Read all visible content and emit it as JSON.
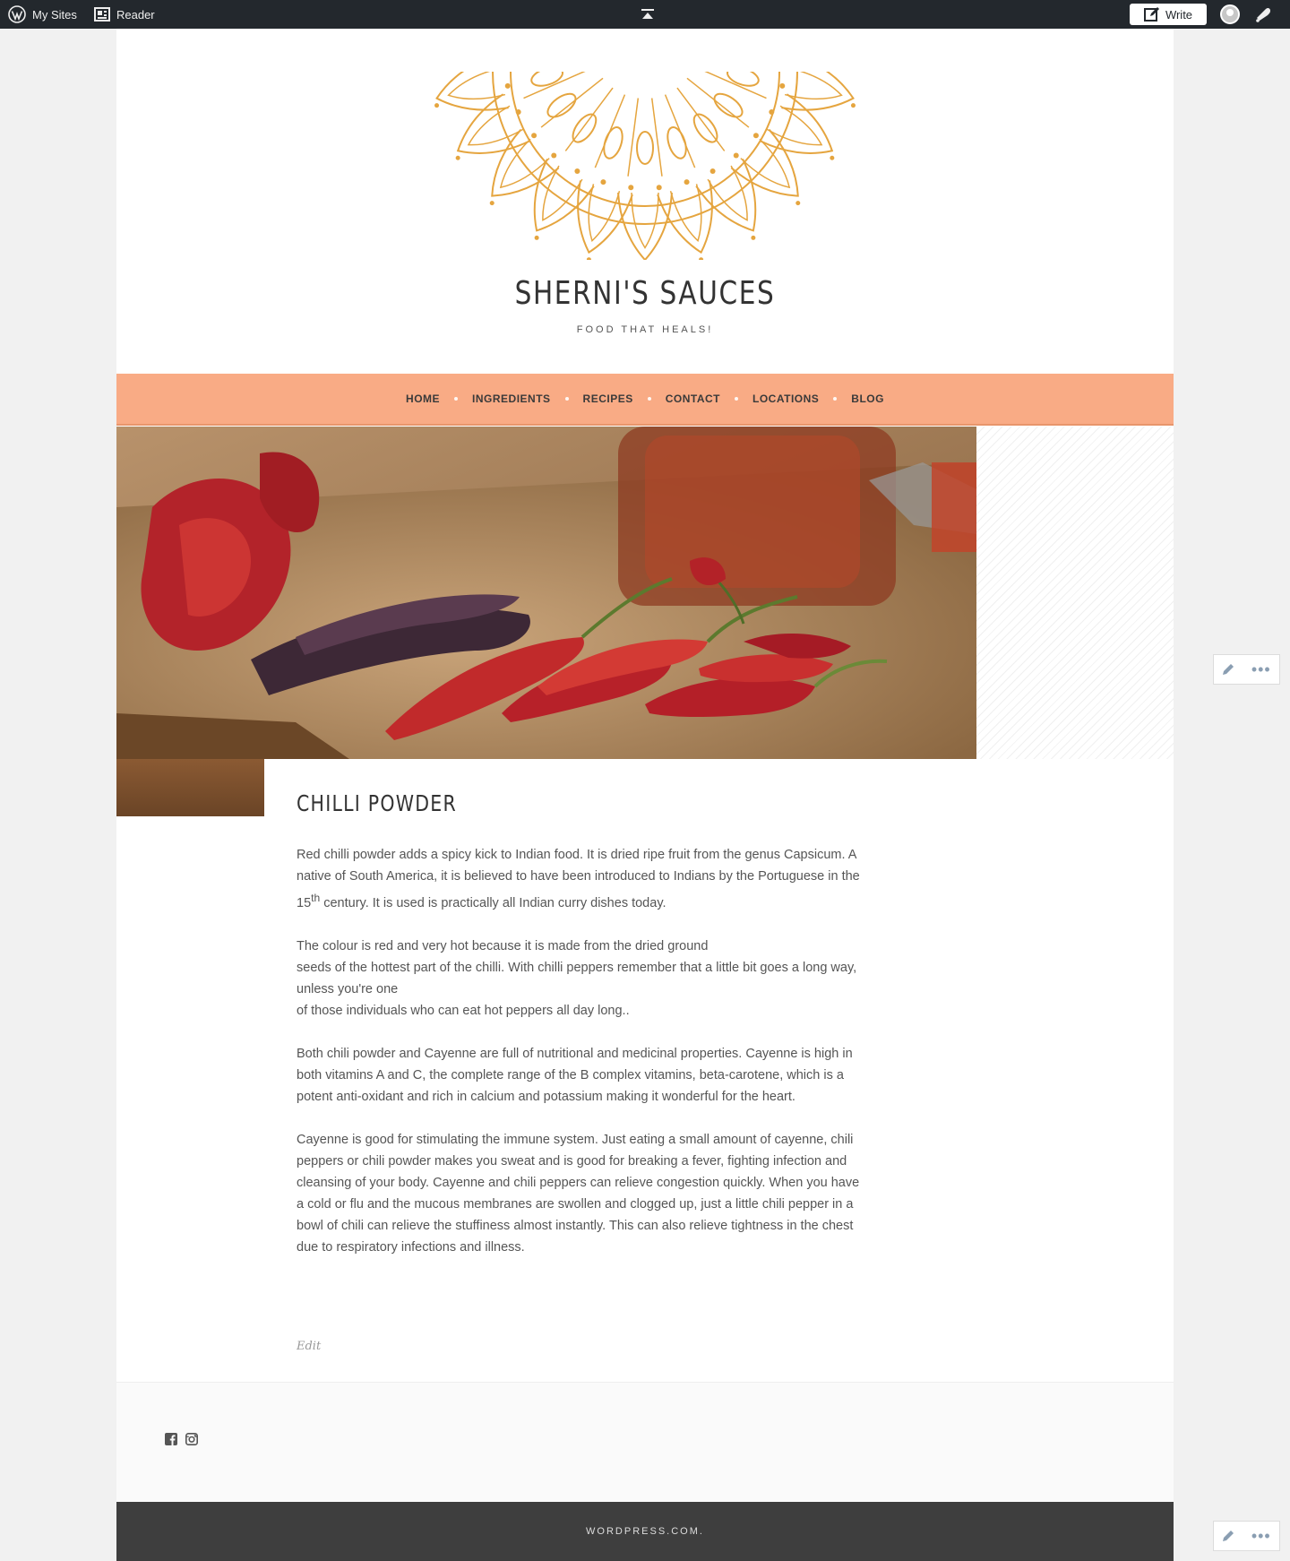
{
  "adminbar": {
    "my_sites": "My Sites",
    "reader": "Reader",
    "write": "Write"
  },
  "site": {
    "title": "SHERNI'S SAUCES",
    "tagline": "FOOD THAT HEALS!"
  },
  "nav": {
    "items": [
      "HOME",
      "INGREDIENTS",
      "RECIPES",
      "CONTACT",
      "LOCATIONS",
      "BLOG"
    ]
  },
  "post": {
    "title": "CHILLI POWDER",
    "para1_a": "Red chilli powder adds a spicy kick to Indian food. It is dried ripe fruit from the genus Capsicum. A native of South America, it is believed to have been introduced to Indians by the Portuguese in the 15",
    "para1_sup": "th",
    "para1_b": " century. It is used is practically all Indian curry dishes today.",
    "para2_line1": "The colour is red and very hot because it is made from the dried ground",
    "para2_line2": "seeds of the hottest part of the chilli. With chilli peppers remember that a little bit goes a long way, unless you're one",
    "para2_line3": "of those individuals who can eat hot peppers all day long..",
    "para3": "Both chili powder and Cayenne are full of nutritional and medicinal properties. Cayenne is high in both vitamins A and C, the complete range of the B complex vitamins, beta-carotene, which is a potent anti-oxidant and rich in calcium and potassium making it wonderful for the heart.",
    "para4": "Cayenne is good for stimulating the immune system. Just eating a small amount of cayenne, chili peppers or chili powder makes you sweat and is good for breaking a fever, fighting infection and cleansing of your body. Cayenne and chili peppers can relieve congestion quickly. When you have a cold or flu and the mucous membranes are swollen and clogged up, just a little chili pepper in a bowl of chili can relieve the stuffiness almost instantly. This can also relieve tightness in the chest due to respiratory infections and illness.",
    "edit": "Edit"
  },
  "footer": {
    "credit": "WORDPRESS.COM.",
    "social_icons": [
      "facebook-icon",
      "instagram-icon"
    ]
  },
  "colors": {
    "adminbar": "#23282d",
    "nav": "#f9ab85",
    "mandala": "#e5a53f",
    "footer": "#3e3e3e"
  },
  "icons": [
    "wordpress-icon",
    "reader-icon",
    "collapse-icon",
    "write-icon",
    "avatar",
    "notifications-icon",
    "pencil-icon",
    "more-icon"
  ]
}
